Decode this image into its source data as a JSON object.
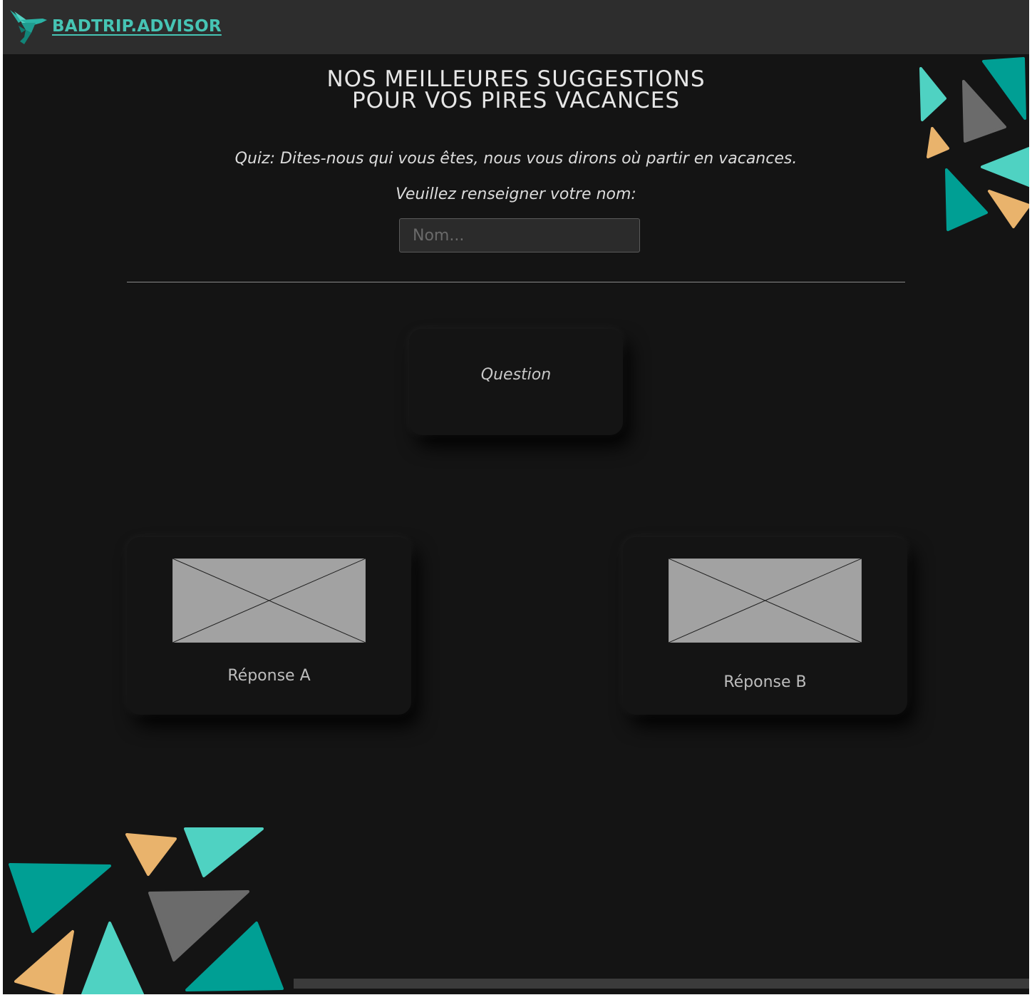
{
  "header": {
    "brand": "BADTRIP.ADVISOR",
    "logo_icon": "hummingbird-icon"
  },
  "hero": {
    "title_line1": "NOS MEILLEURES SUGGESTIONS",
    "title_line2": "POUR VOS PIRES VACANCES"
  },
  "quiz": {
    "intro": "Quiz: Dites-nous qui vous êtes, nous vous dirons où partir en vacances.",
    "name_prompt": "Veuillez renseigner votre nom:",
    "name_placeholder": "Nom...",
    "name_value": "",
    "question": "Question",
    "answers": [
      {
        "label": "Réponse A",
        "image_icon": "image-placeholder-icon"
      },
      {
        "label": "Réponse B",
        "image_icon": "image-placeholder-icon"
      }
    ]
  },
  "colors": {
    "brand_teal": "#46c4b4",
    "teal_light": "#4fd2c2",
    "teal_dark": "#009f94",
    "orange": "#e9b36c",
    "gray_shape": "#6b6b6b",
    "background": "#141414",
    "topbar": "#2d2d2d"
  }
}
